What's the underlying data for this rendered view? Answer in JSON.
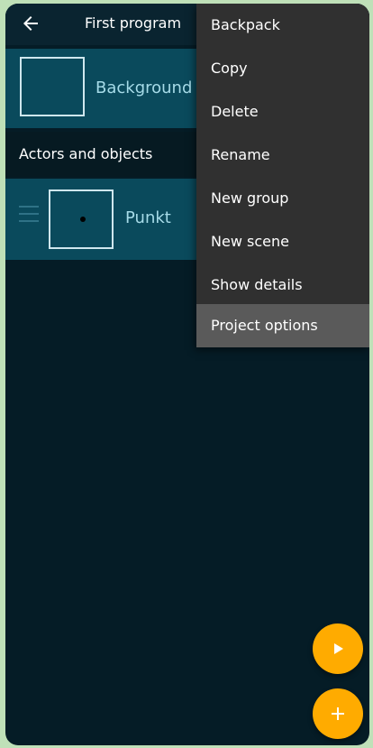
{
  "app_bar": {
    "title": "First program",
    "back_icon": "arrow-left-icon"
  },
  "background": {
    "label": "Background"
  },
  "section": {
    "label": "Actors and objects"
  },
  "actors": [
    {
      "label": "Punkt"
    }
  ],
  "menu": {
    "items": [
      {
        "label": "Backpack"
      },
      {
        "label": "Copy"
      },
      {
        "label": "Delete"
      },
      {
        "label": "Rename"
      },
      {
        "label": "New group"
      },
      {
        "label": "New scene"
      },
      {
        "label": "Show details"
      },
      {
        "label": "Project options",
        "selected": true
      }
    ]
  },
  "fabs": {
    "play_icon": "play-icon",
    "add_icon": "plus-icon",
    "color": "#ffab00"
  },
  "colors": {
    "background": "#051c26",
    "item_background": "#0a4a5c",
    "menu_background": "#303030",
    "accent": "#ffab00"
  }
}
